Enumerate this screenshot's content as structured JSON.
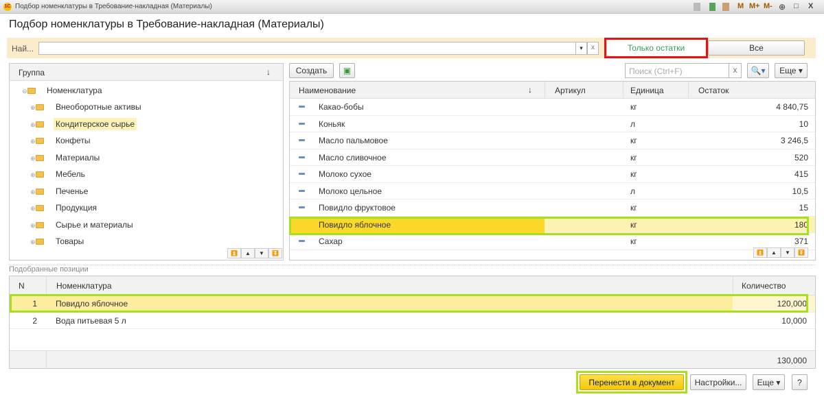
{
  "window": {
    "title": "Подбор номенклатуры в Требование-накладная (Материалы)",
    "logo": "1С",
    "buttons": [
      "M",
      "M+",
      "M-",
      "□",
      "X"
    ]
  },
  "heading": "Подбор номенклатуры в Требование-накладная (Материалы)",
  "search": {
    "label": "Най...",
    "value": "",
    "clear": "x",
    "dropdown": "▾"
  },
  "filters": {
    "only_stock": "Только остатки",
    "all": "Все"
  },
  "groups": {
    "header": "Группа",
    "sort": "↓",
    "root": "Номенклатура",
    "items": [
      "Внеоборотные активы",
      "Кондитерское сырье",
      "Конфеты",
      "Материалы",
      "Мебель",
      "Печенье",
      "Продукция",
      "Сырье и материалы",
      "Товары"
    ]
  },
  "toolbar": {
    "create": "Создать",
    "search_placeholder": "Поиск (Ctrl+F)",
    "clear": "x",
    "more": "Еще ▾"
  },
  "items": {
    "columns": [
      "Наименование",
      "Артикул",
      "Единица",
      "Остаток"
    ],
    "sort": "↓",
    "rows": [
      {
        "name": "Какао-бобы",
        "article": "",
        "unit": "кг",
        "stock": "4 840,75"
      },
      {
        "name": "Коньяк",
        "article": "",
        "unit": "л",
        "stock": "10"
      },
      {
        "name": "Масло пальмовое",
        "article": "",
        "unit": "кг",
        "stock": "3 246,5"
      },
      {
        "name": "Масло сливочное",
        "article": "",
        "unit": "кг",
        "stock": "520"
      },
      {
        "name": "Молоко сухое",
        "article": "",
        "unit": "кг",
        "stock": "415"
      },
      {
        "name": "Молоко цельное",
        "article": "",
        "unit": "л",
        "stock": "10,5"
      },
      {
        "name": "Повидло фруктовое",
        "article": "",
        "unit": "кг",
        "stock": "15"
      },
      {
        "name": "Повидло яблочное",
        "article": "",
        "unit": "кг",
        "stock": "180"
      },
      {
        "name": "Сахар",
        "article": "",
        "unit": "кг",
        "stock": "371"
      }
    ]
  },
  "selected": {
    "title": "Подобранные позиции",
    "columns": [
      "N",
      "Номенклатура",
      "Количество"
    ],
    "rows": [
      {
        "n": "1",
        "name": "Повидло яблочное",
        "qty": "120,000"
      },
      {
        "n": "2",
        "name": "Вода питьевая 5 л",
        "qty": "10,000"
      }
    ],
    "total": "130,000"
  },
  "footer": {
    "transfer": "Перенести в документ",
    "settings": "Настройки...",
    "more": "Еще ▾",
    "help": "?"
  },
  "colors": {
    "highlight": "#fbd92a",
    "selected_row": "#fcf0b4",
    "green_outline": "#a8e020",
    "red_outline": "#e0141c"
  }
}
